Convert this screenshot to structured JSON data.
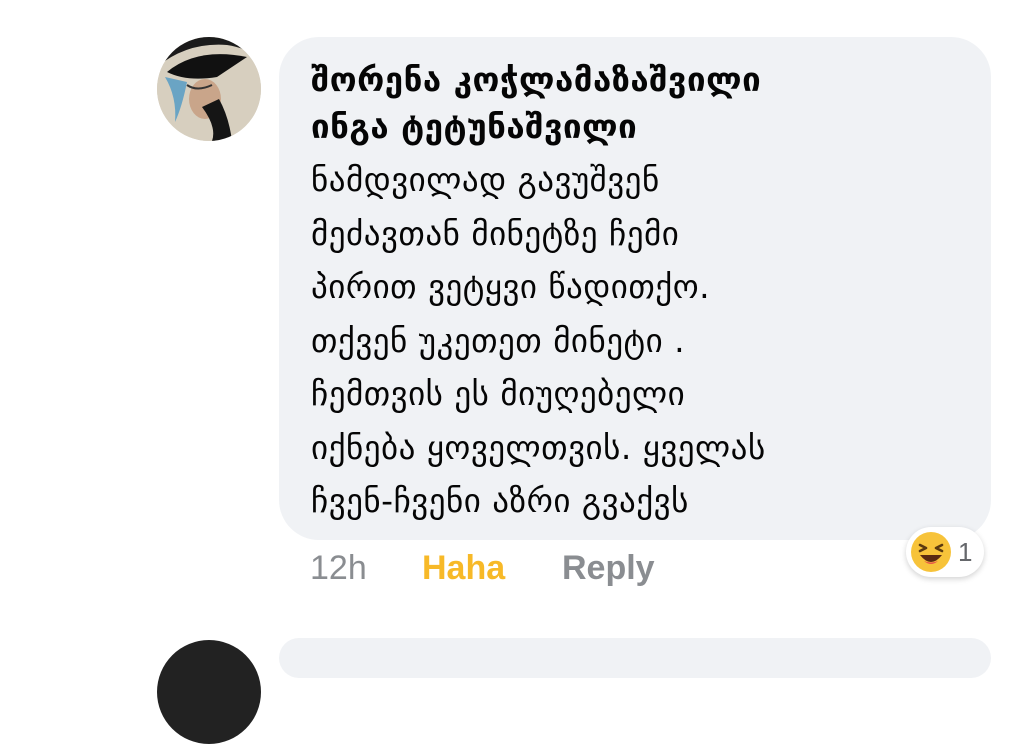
{
  "comment": {
    "author": "შორენა კოჭლამაზაშვილი",
    "mention": "ინგა ტეტუნაშვილი",
    "body_lines": [
      "ნამდვილად გავუშვენ",
      "მეძავთან მინეტზე ჩემი",
      "პირით ვეტყვი წადითქო.",
      "თქვენ უკეთეთ მინეტი .",
      "ჩემთვის ეს მიუღებელი",
      "იქნება ყოველთვის. ყველას",
      "ჩვენ-ჩვენი აზრი გვაქვს"
    ],
    "time": "12h",
    "reaction_label": "Haha",
    "reply_label": "Reply",
    "reaction_count": "1",
    "reaction_icon": "haha-emoji-icon"
  },
  "colors": {
    "bubble": "#f0f2f5",
    "haha": "#f7b928",
    "meta_gray": "#8a8d91"
  }
}
